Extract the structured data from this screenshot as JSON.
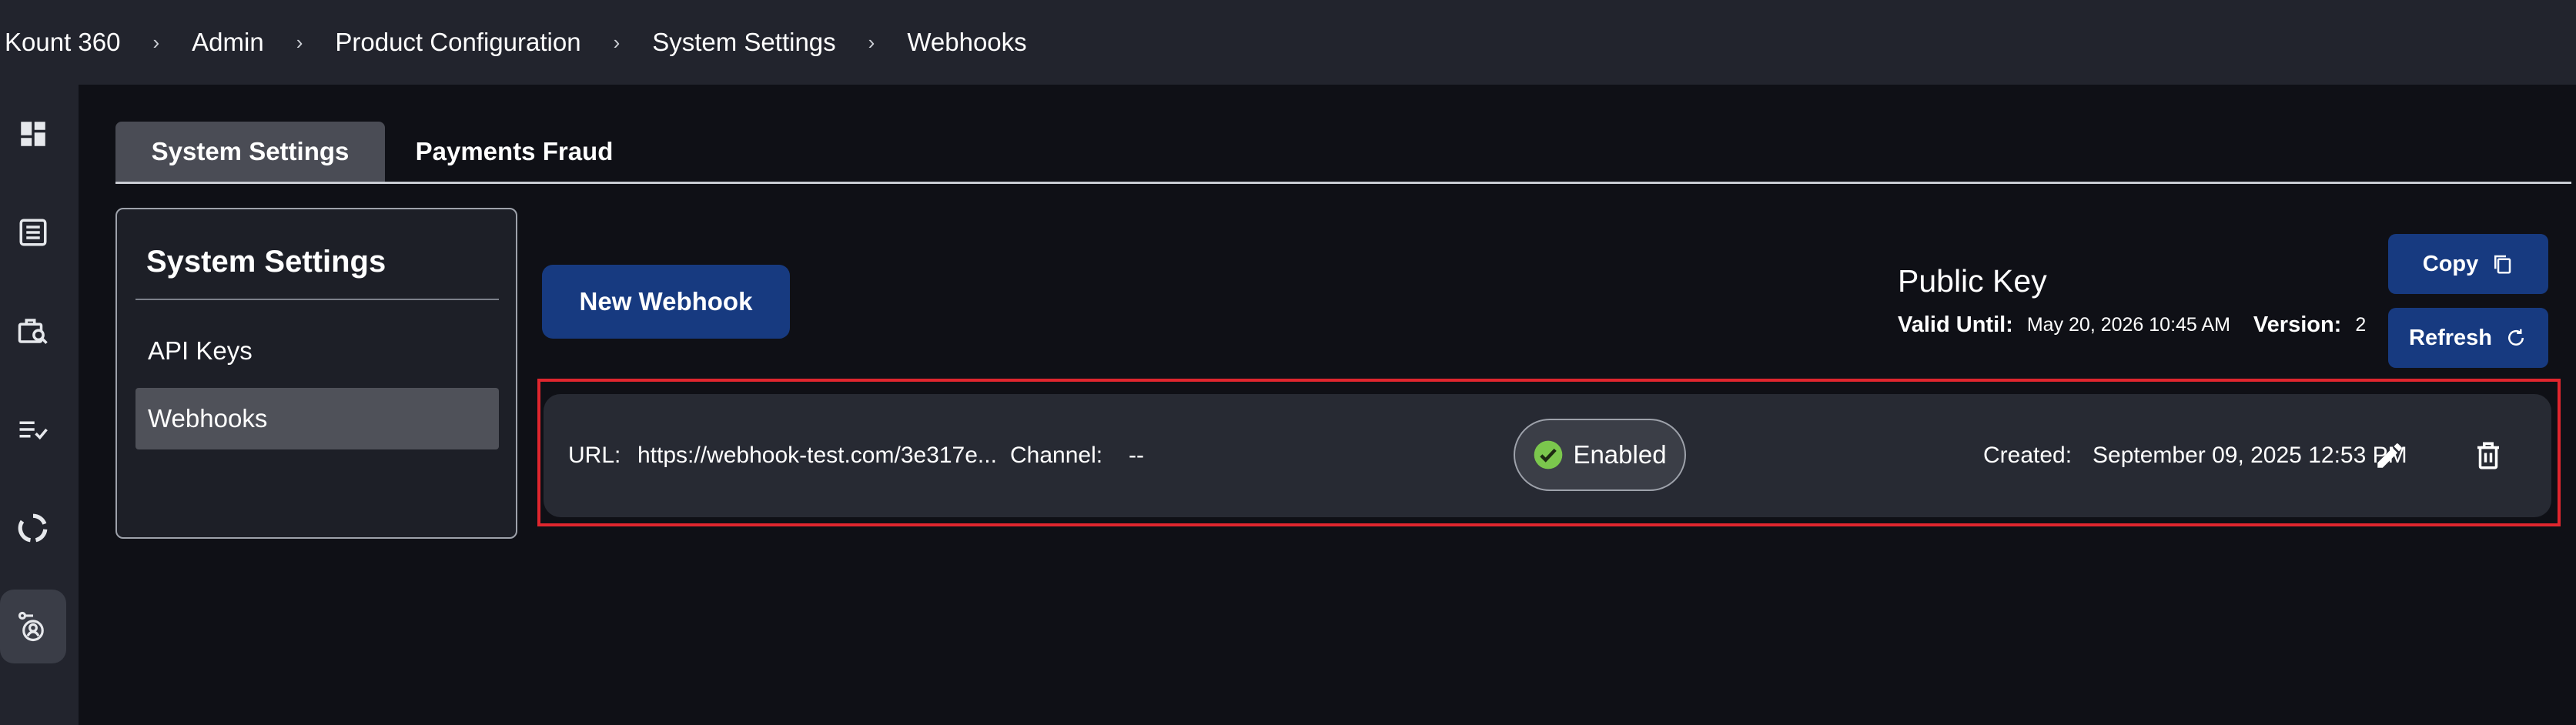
{
  "breadcrumb": {
    "items": [
      "Kount 360",
      "Admin",
      "Product Configuration",
      "System Settings",
      "Webhooks"
    ],
    "separator": "›"
  },
  "sidebar": {
    "icons": [
      "dashboard-icon",
      "list-icon",
      "briefcase-search-icon",
      "checklist-icon",
      "donut-chart-icon",
      "admin-user-icon"
    ],
    "active_index": 5
  },
  "tabs": [
    {
      "label": "System Settings",
      "active": true
    },
    {
      "label": "Payments Fraud",
      "active": false
    }
  ],
  "settings_panel": {
    "title": "System Settings",
    "items": [
      {
        "label": "API Keys",
        "active": false
      },
      {
        "label": "Webhooks",
        "active": true
      }
    ]
  },
  "actions": {
    "new_webhook_label": "New Webhook"
  },
  "public_key": {
    "title": "Public Key",
    "valid_until_label": "Valid Until:",
    "valid_until_value": "May 20, 2026 10:45 AM",
    "version_label": "Version:",
    "version_value": "2",
    "copy_label": "Copy",
    "refresh_label": "Refresh"
  },
  "webhook": {
    "url_label": "URL:",
    "url_value": "https://webhook-test.com/3e317e...",
    "channel_label": "Channel:",
    "channel_value": "--",
    "status": "Enabled",
    "created_label": "Created:",
    "created_value": "September 09, 2025 12:53 PM"
  },
  "colors": {
    "accent_blue": "#173a80",
    "highlight_red": "#e0262e",
    "enabled_green": "#7bc74d"
  }
}
